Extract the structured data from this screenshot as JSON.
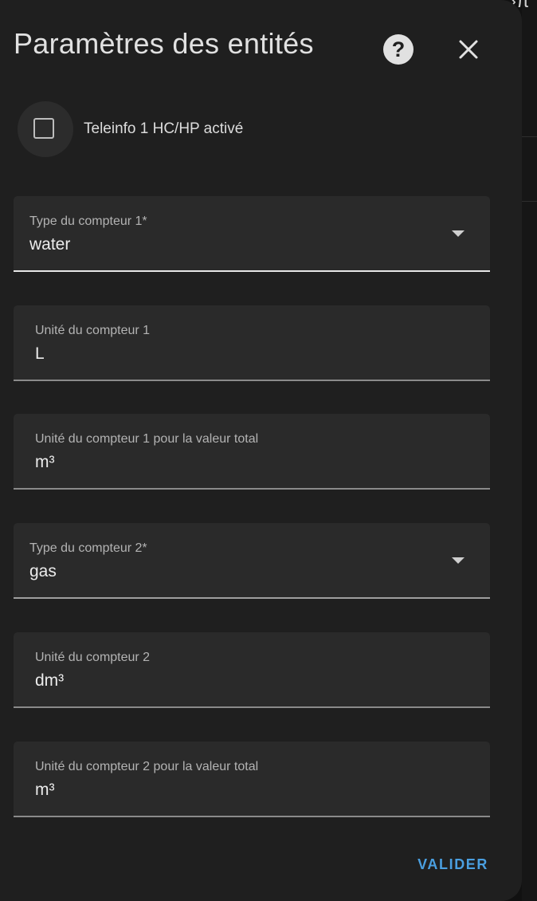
{
  "dialog": {
    "title": "Paramètres des entités",
    "help_icon": "help-circle-icon",
    "close_icon": "close-icon"
  },
  "checkbox": {
    "label": "Teleinfo 1 HC/HP activé",
    "checked": false
  },
  "fields": [
    {
      "kind": "select",
      "label": "Type du compteur 1*",
      "value": "water"
    },
    {
      "kind": "text",
      "label": "Unité du compteur 1",
      "value": "L"
    },
    {
      "kind": "text",
      "label": "Unité du compteur 1 pour la valeur total",
      "value": "m³"
    },
    {
      "kind": "select",
      "label": "Type du compteur 2*",
      "value": "gas"
    },
    {
      "kind": "text",
      "label": "Unité du compteur 2",
      "value": "dm³"
    },
    {
      "kind": "text",
      "label": "Unité du compteur 2 pour la valeur total",
      "value": "m³"
    }
  ],
  "actions": {
    "submit_label": "VALIDER"
  },
  "colors": {
    "accent": "#4a9fe0",
    "surface": "#1f1f1f",
    "field_fill": "#2a2a2a"
  }
}
